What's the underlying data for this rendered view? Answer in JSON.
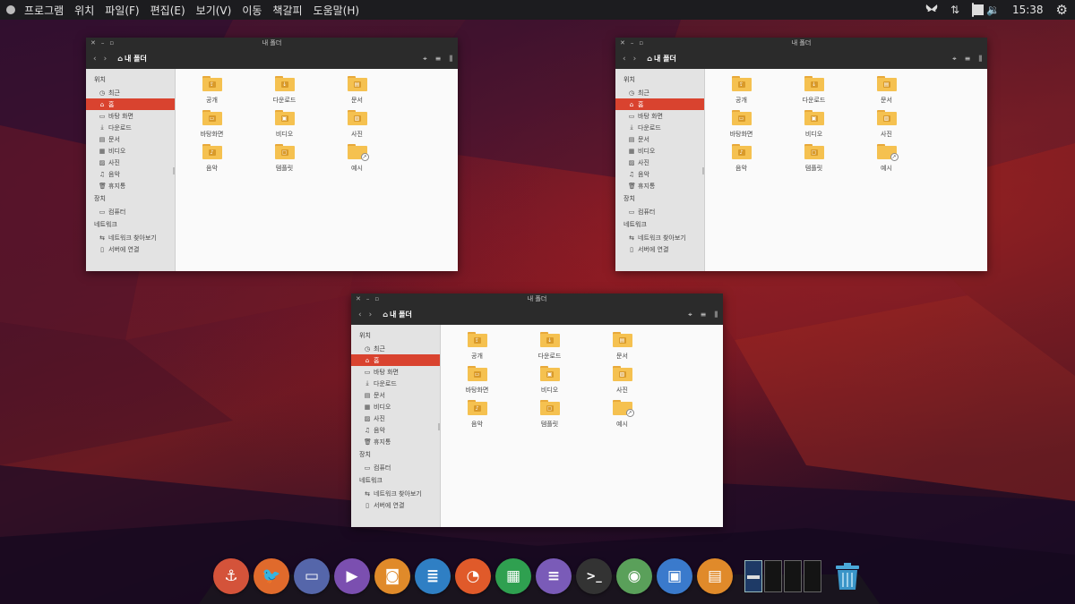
{
  "top_panel": {
    "menu": [
      "프로그램",
      "위치",
      "파일(F)",
      "편집(E)",
      "보기(V)",
      "이동",
      "책갈피",
      "도움말(H)"
    ],
    "clock": "15:38",
    "tray_icons": [
      "butterfly-icon",
      "network-arrows-icon",
      "battery-icon",
      "volume-icon"
    ],
    "battery_level": 0.7
  },
  "window": {
    "title": "내 폴더",
    "breadcrumb": "내 폴더",
    "sidebar": {
      "sections": [
        {
          "label": "위치",
          "items": [
            {
              "icon": "recent-icon",
              "label": "최근"
            },
            {
              "icon": "home-icon",
              "label": "홈",
              "active": true
            },
            {
              "icon": "desktop-icon",
              "label": "바탕 화면"
            },
            {
              "icon": "download-icon",
              "label": "다운로드"
            },
            {
              "icon": "document-icon",
              "label": "문서"
            },
            {
              "icon": "video-icon",
              "label": "비디오"
            },
            {
              "icon": "picture-icon",
              "label": "사진"
            },
            {
              "icon": "music-icon",
              "label": "음악"
            },
            {
              "icon": "trash-icon",
              "label": "휴지통"
            }
          ]
        },
        {
          "label": "장치",
          "items": [
            {
              "icon": "computer-icon",
              "label": "컴퓨터"
            }
          ]
        },
        {
          "label": "네트워크",
          "items": [
            {
              "icon": "network-icon",
              "label": "네트워크 찾아보기"
            },
            {
              "icon": "server-icon",
              "label": "서버에 연결"
            }
          ]
        }
      ]
    },
    "folders": [
      {
        "name": "공개",
        "emblem": "share"
      },
      {
        "name": "다운로드",
        "emblem": "download"
      },
      {
        "name": "문서",
        "emblem": "document"
      },
      {
        "name": "바탕화면",
        "emblem": "desktop"
      },
      {
        "name": "비디오",
        "emblem": "video"
      },
      {
        "name": "사진",
        "emblem": "picture"
      },
      {
        "name": "음악",
        "emblem": "music"
      },
      {
        "name": "템플릿",
        "emblem": "template"
      },
      {
        "name": "예시",
        "emblem": "link"
      }
    ]
  },
  "dock": {
    "apps": [
      {
        "name": "anchor-app-icon",
        "color": "#d4533a",
        "glyph": "⚓"
      },
      {
        "name": "twitter-app-icon",
        "color": "#e06a2c",
        "glyph": "🐦"
      },
      {
        "name": "files-app-icon",
        "color": "#5566aa",
        "glyph": "▭"
      },
      {
        "name": "media-player-icon",
        "color": "#7b4fb0",
        "glyph": "▶"
      },
      {
        "name": "speaker-app-icon",
        "color": "#e08a2a",
        "glyph": "◙"
      },
      {
        "name": "text-editor-icon",
        "color": "#2f7fc4",
        "glyph": "≣"
      },
      {
        "name": "presentation-app-icon",
        "color": "#e05a2a",
        "glyph": "◔"
      },
      {
        "name": "spreadsheet-app-icon",
        "color": "#2fa050",
        "glyph": "▦"
      },
      {
        "name": "document-viewer-icon",
        "color": "#7a5bb8",
        "glyph": "≡"
      },
      {
        "name": "terminal-icon",
        "color": "#333333",
        "glyph": ">_"
      },
      {
        "name": "settings-toggle-icon",
        "color": "#5aa05a",
        "glyph": "◉"
      },
      {
        "name": "archive-app-icon",
        "color": "#3a7acc",
        "glyph": "▣"
      },
      {
        "name": "software-center-icon",
        "color": "#e08a2a",
        "glyph": "▤"
      }
    ],
    "workspaces": 4,
    "active_workspace": 1
  }
}
